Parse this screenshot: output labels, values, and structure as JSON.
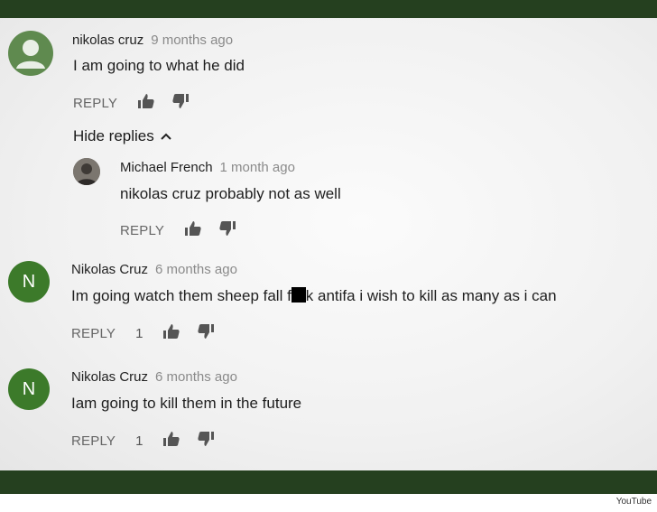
{
  "comments": [
    {
      "author": "nikolas cruz",
      "time": "9 months ago",
      "text": "I am going to what he did",
      "reply_label": "REPLY",
      "likes": "",
      "avatar_letter": ""
    },
    {
      "author": "Michael French",
      "time": "1 month ago",
      "text": "nikolas cruz probably not as well",
      "reply_label": "REPLY",
      "likes": "",
      "avatar_letter": ""
    },
    {
      "author": "Nikolas Cruz",
      "time": "6 months ago",
      "text_before": "Im going watch them sheep fall f",
      "text_after": "k antifa i wish to kill as many as i can",
      "reply_label": "REPLY",
      "likes": "1",
      "avatar_letter": "N"
    },
    {
      "author": "Nikolas Cruz",
      "time": "6 months ago",
      "text": "Iam going to kill them in the future",
      "reply_label": "REPLY",
      "likes": "1",
      "avatar_letter": "N"
    }
  ],
  "hide_replies_label": "Hide replies",
  "credit": "YouTube",
  "colors": {
    "band": "#25401f",
    "letter_avatar": "#3c7a2a",
    "generic_avatar": "#5f8a4f"
  },
  "icons": [
    "person-icon",
    "thumbs-up-icon",
    "thumbs-down-icon",
    "chevron-up-icon"
  ]
}
